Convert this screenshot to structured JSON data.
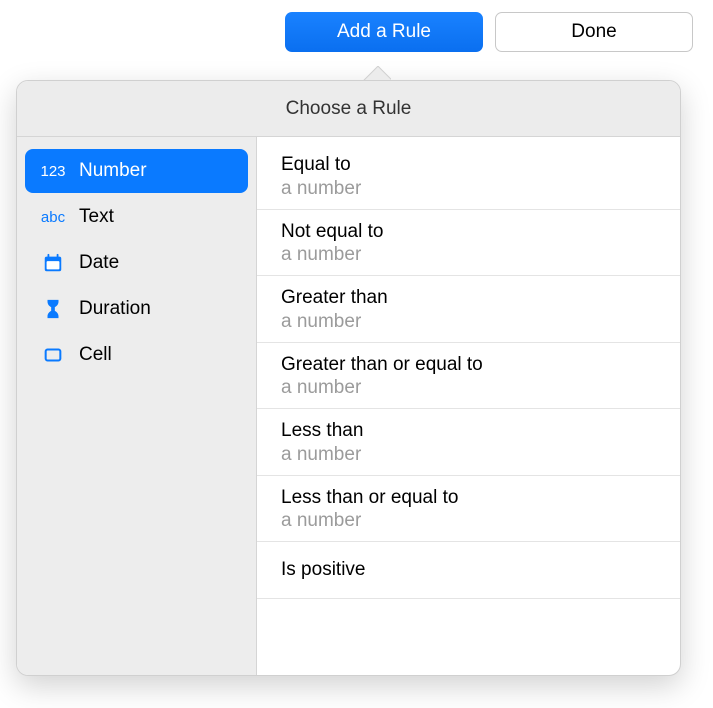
{
  "toolbar": {
    "add_label": "Add a Rule",
    "done_label": "Done"
  },
  "popover": {
    "title": "Choose a Rule"
  },
  "sidebar": {
    "items": [
      {
        "label": "Number",
        "icon_text": "123"
      },
      {
        "label": "Text",
        "icon_text": "abc"
      },
      {
        "label": "Date"
      },
      {
        "label": "Duration"
      },
      {
        "label": "Cell"
      }
    ]
  },
  "rules": [
    {
      "title": "Equal to",
      "sub": "a number"
    },
    {
      "title": "Not equal to",
      "sub": "a number"
    },
    {
      "title": "Greater than",
      "sub": "a number"
    },
    {
      "title": "Greater than or equal to",
      "sub": "a number"
    },
    {
      "title": "Less than",
      "sub": "a number"
    },
    {
      "title": "Less than or equal to",
      "sub": "a number"
    },
    {
      "title": "Is positive",
      "sub": ""
    }
  ]
}
